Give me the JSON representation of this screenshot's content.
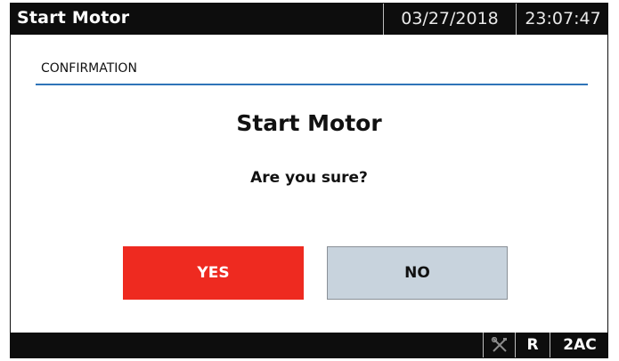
{
  "header": {
    "title": "Start Motor",
    "date": "03/27/2018",
    "time": "23:07:47"
  },
  "section": {
    "label": "CONFIRMATION"
  },
  "dialog": {
    "title": "Start Motor",
    "question": "Are you sure?",
    "yes_label": "YES",
    "no_label": "NO"
  },
  "footer": {
    "tools_icon": "wrench-screwdriver-icon",
    "mode": "R",
    "level": "2AC"
  },
  "colors": {
    "yes_button": "#ee2a20",
    "no_button": "#c8d3dd",
    "accent_line": "#2f74b8",
    "bar_background": "#0d0d0d"
  }
}
